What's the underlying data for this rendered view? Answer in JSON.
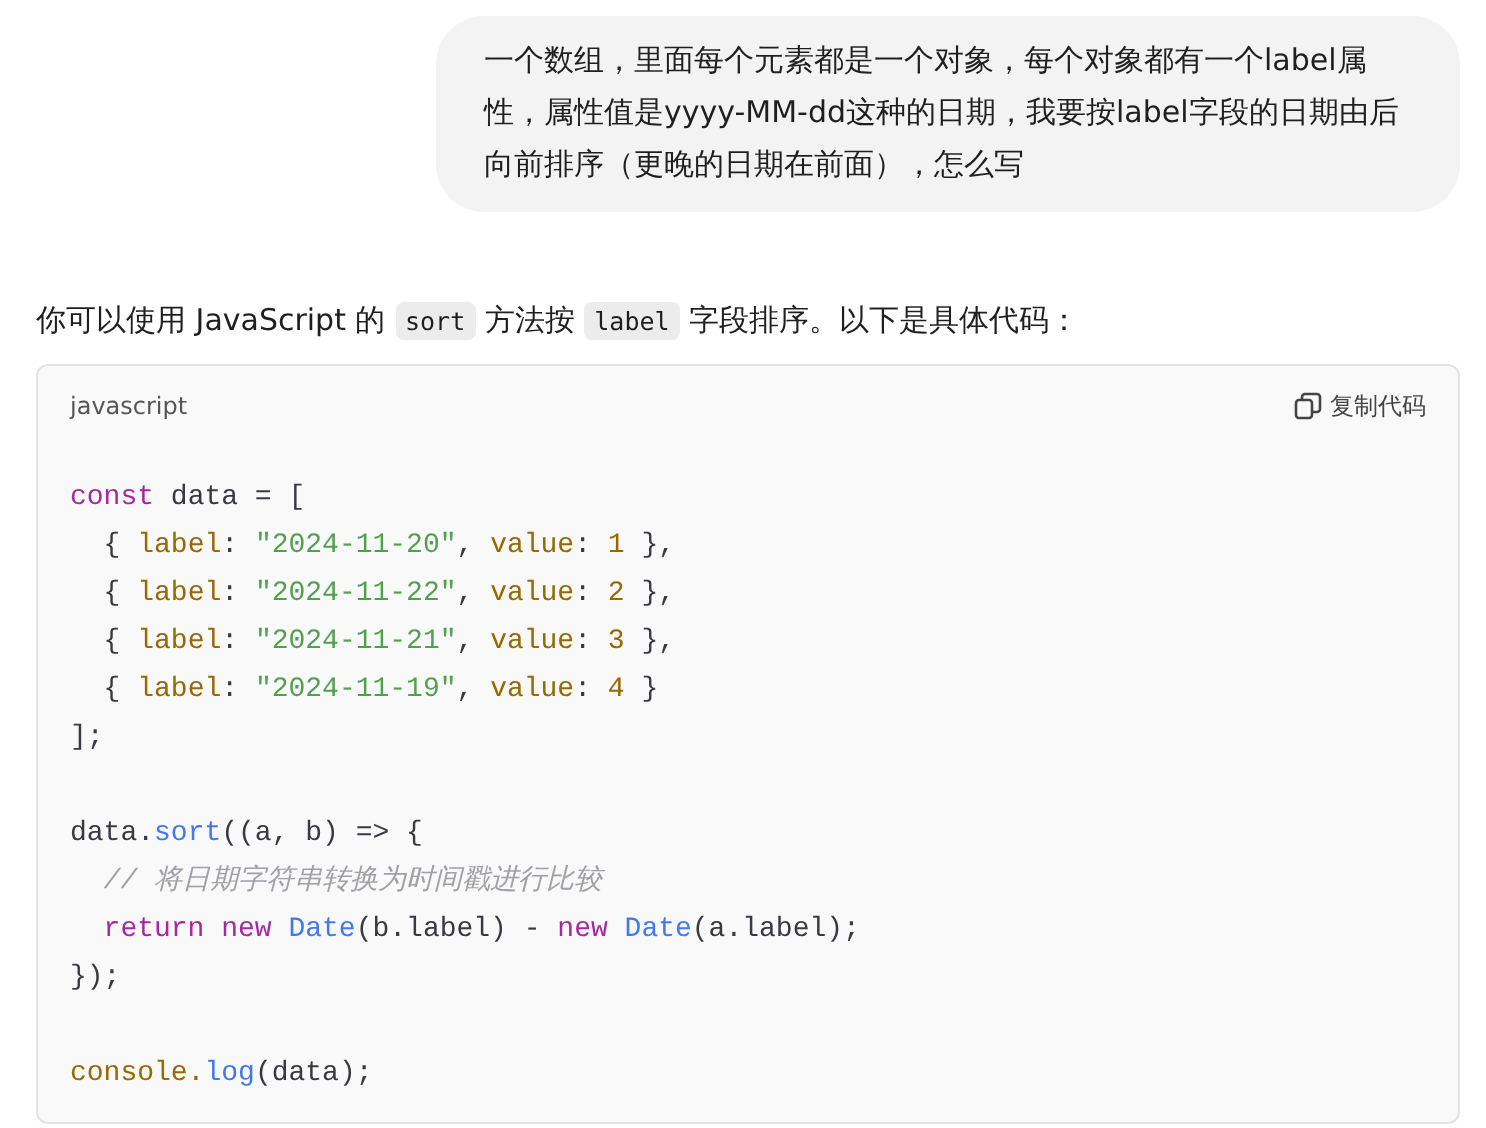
{
  "user_message": "一个数组，里面每个元素都是一个对象，每个对象都有一个label属性，属性值是yyyy-MM-dd这种的日期，我要按label字段的日期由后向前排序（更晚的日期在前面），怎么写",
  "answer": {
    "intro": [
      {
        "kind": "text",
        "text": "你可以使用 JavaScript 的 "
      },
      {
        "kind": "code",
        "text": "sort"
      },
      {
        "kind": "text",
        "text": " 方法按 "
      },
      {
        "kind": "code",
        "text": "label"
      },
      {
        "kind": "text",
        "text": " 字段排序。以下是具体代码："
      }
    ],
    "code_block": {
      "language": "javascript",
      "copy_label": "复制代码",
      "lines": [
        {
          "kind": "code",
          "tokens": [
            {
              "kind": "keyword",
              "text": "const"
            },
            {
              "kind": "plain",
              "text": " data = ["
            }
          ]
        },
        {
          "kind": "code",
          "tokens": [
            {
              "kind": "plain",
              "text": "  { "
            },
            {
              "kind": "property",
              "text": "label"
            },
            {
              "kind": "plain",
              "text": ": "
            },
            {
              "kind": "string",
              "text": "\"2024-11-20\""
            },
            {
              "kind": "plain",
              "text": ", "
            },
            {
              "kind": "property",
              "text": "value"
            },
            {
              "kind": "plain",
              "text": ": "
            },
            {
              "kind": "number",
              "text": "1"
            },
            {
              "kind": "plain",
              "text": " },"
            }
          ]
        },
        {
          "kind": "code",
          "tokens": [
            {
              "kind": "plain",
              "text": "  { "
            },
            {
              "kind": "property",
              "text": "label"
            },
            {
              "kind": "plain",
              "text": ": "
            },
            {
              "kind": "string",
              "text": "\"2024-11-22\""
            },
            {
              "kind": "plain",
              "text": ", "
            },
            {
              "kind": "property",
              "text": "value"
            },
            {
              "kind": "plain",
              "text": ": "
            },
            {
              "kind": "number",
              "text": "2"
            },
            {
              "kind": "plain",
              "text": " },"
            }
          ]
        },
        {
          "kind": "code",
          "tokens": [
            {
              "kind": "plain",
              "text": "  { "
            },
            {
              "kind": "property",
              "text": "label"
            },
            {
              "kind": "plain",
              "text": ": "
            },
            {
              "kind": "string",
              "text": "\"2024-11-21\""
            },
            {
              "kind": "plain",
              "text": ", "
            },
            {
              "kind": "property",
              "text": "value"
            },
            {
              "kind": "plain",
              "text": ": "
            },
            {
              "kind": "number",
              "text": "3"
            },
            {
              "kind": "plain",
              "text": " },"
            }
          ]
        },
        {
          "kind": "code",
          "tokens": [
            {
              "kind": "plain",
              "text": "  { "
            },
            {
              "kind": "property",
              "text": "label"
            },
            {
              "kind": "plain",
              "text": ": "
            },
            {
              "kind": "string",
              "text": "\"2024-11-19\""
            },
            {
              "kind": "plain",
              "text": ", "
            },
            {
              "kind": "property",
              "text": "value"
            },
            {
              "kind": "plain",
              "text": ": "
            },
            {
              "kind": "number",
              "text": "4"
            },
            {
              "kind": "plain",
              "text": " }"
            }
          ]
        },
        {
          "kind": "code",
          "tokens": [
            {
              "kind": "plain",
              "text": "];"
            }
          ]
        },
        {
          "kind": "blank"
        },
        {
          "kind": "code",
          "tokens": [
            {
              "kind": "plain",
              "text": "data."
            },
            {
              "kind": "function",
              "text": "sort"
            },
            {
              "kind": "plain",
              "text": "((a, b) => {"
            }
          ]
        },
        {
          "kind": "code",
          "tokens": [
            {
              "kind": "comment",
              "text": "  // 将日期字符串转换为时间戳进行比较"
            }
          ]
        },
        {
          "kind": "code",
          "tokens": [
            {
              "kind": "keyword",
              "text": "  return new"
            },
            {
              "kind": "function",
              "text": " Date"
            },
            {
              "kind": "plain",
              "text": "(b.label) - "
            },
            {
              "kind": "keyword",
              "text": "new"
            },
            {
              "kind": "function",
              "text": " Date"
            },
            {
              "kind": "plain",
              "text": "(a.label);"
            }
          ]
        },
        {
          "kind": "code",
          "tokens": [
            {
              "kind": "plain",
              "text": "});"
            }
          ]
        },
        {
          "kind": "blank"
        },
        {
          "kind": "code",
          "tokens": [
            {
              "kind": "variable",
              "text": "console."
            },
            {
              "kind": "function",
              "text": "log"
            },
            {
              "kind": "plain",
              "text": "(data);"
            }
          ]
        }
      ]
    }
  }
}
